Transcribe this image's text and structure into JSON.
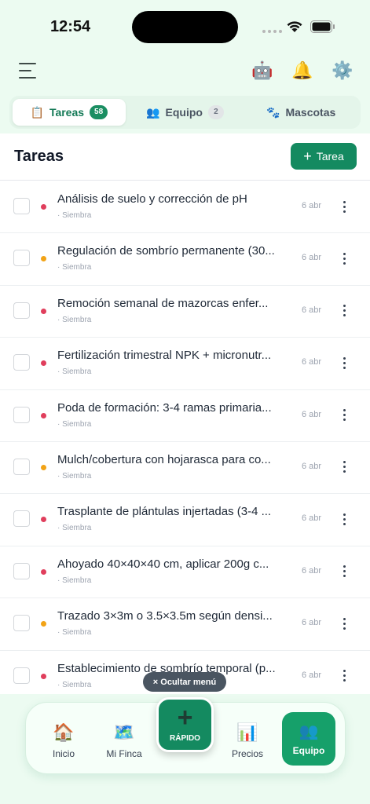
{
  "status_bar": {
    "time": "12:54"
  },
  "header": {
    "icons": [
      "menu-icon",
      "robot-icon",
      "bell-icon",
      "gear-icon"
    ]
  },
  "tabs": [
    {
      "icon": "📋",
      "label": "Tareas",
      "count": "58",
      "active": true
    },
    {
      "icon": "👥",
      "label": "Equipo",
      "count": "2",
      "active": false
    },
    {
      "icon": "🐾",
      "label": "Mascotas",
      "active": false
    }
  ],
  "section": {
    "title": "Tareas",
    "add_label": "Tarea"
  },
  "tasks": [
    {
      "title": "Análisis de suelo y corrección de pH",
      "category": "· Siembra",
      "date": "6 abr",
      "priority_color": "#e03e5c"
    },
    {
      "title": "Regulación de sombrío permanente (30...",
      "category": "· Siembra",
      "date": "6 abr",
      "priority_color": "#f2a316"
    },
    {
      "title": "Remoción semanal de mazorcas enfer...",
      "category": "· Siembra",
      "date": "6 abr",
      "priority_color": "#e03e5c"
    },
    {
      "title": "Fertilización trimestral NPK + micronutr...",
      "category": "· Siembra",
      "date": "6 abr",
      "priority_color": "#e03e5c"
    },
    {
      "title": "Poda de formación: 3-4 ramas primaria...",
      "category": "· Siembra",
      "date": "6 abr",
      "priority_color": "#e03e5c"
    },
    {
      "title": "Mulch/cobertura con hojarasca para co...",
      "category": "· Siembra",
      "date": "6 abr",
      "priority_color": "#f2a316"
    },
    {
      "title": "Trasplante de plántulas injertadas (3-4 ...",
      "category": "· Siembra",
      "date": "6 abr",
      "priority_color": "#e03e5c"
    },
    {
      "title": "Ahoyado 40×40×40 cm, aplicar 200g c...",
      "category": "· Siembra",
      "date": "6 abr",
      "priority_color": "#e03e5c"
    },
    {
      "title": "Trazado 3×3m o 3.5×3.5m según densi...",
      "category": "· Siembra",
      "date": "6 abr",
      "priority_color": "#f2a316"
    },
    {
      "title": "Establecimiento de sombrío temporal (p...",
      "category": "· Siembra",
      "date": "6 abr",
      "priority_color": "#e03e5c"
    }
  ],
  "hide_menu_label": "× Ocultar menú",
  "bottom_nav": {
    "inicio": {
      "icon": "🏠",
      "label": "Inicio"
    },
    "finca": {
      "icon": "🗺️",
      "label": "Mi Finca"
    },
    "quick": {
      "label": "RÁPIDO"
    },
    "precios": {
      "icon": "📊",
      "label": "Precios"
    },
    "equipo": {
      "icon": "👥",
      "label": "Equipo",
      "active": true
    }
  }
}
